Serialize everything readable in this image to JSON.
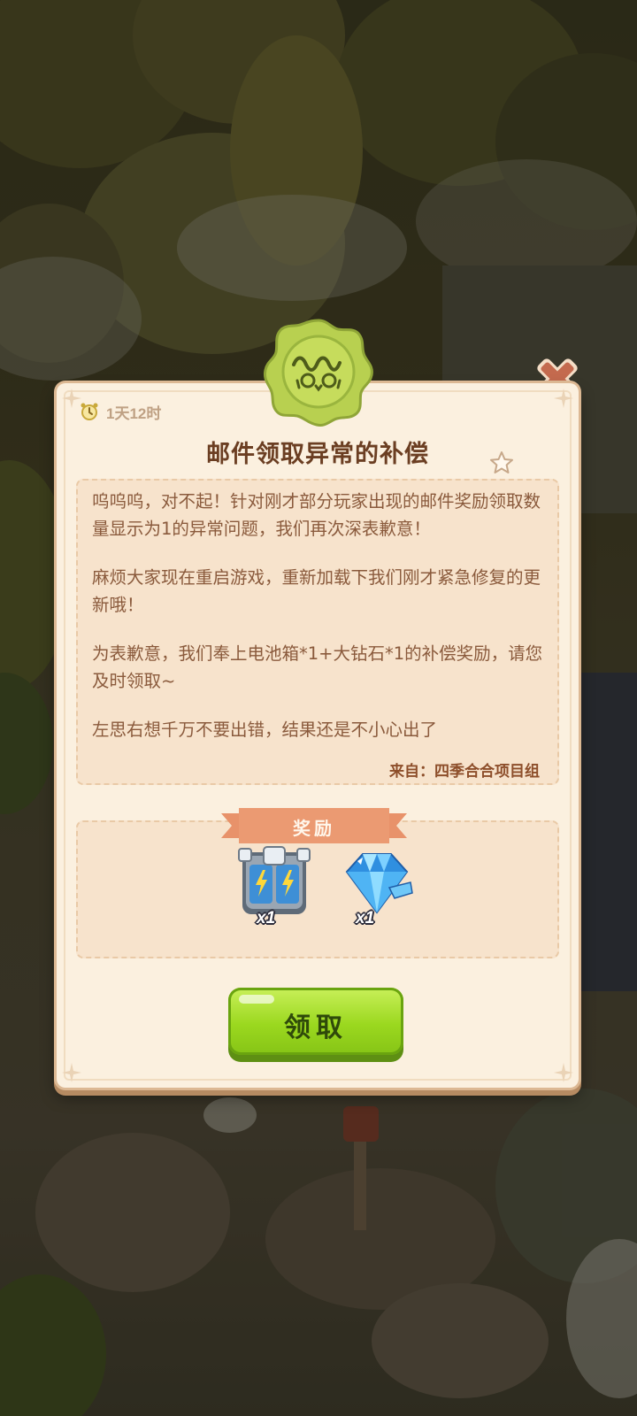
{
  "mail": {
    "time_left": "1天12时",
    "title": "邮件领取异常的补偿",
    "body": [
      "呜呜呜，对不起！针对刚才部分玩家出现的邮件奖励领取数量显示为1的异常问题，我们再次深表歉意！",
      "麻烦大家现在重启游戏，重新加载下我们刚才紧急修复的更新哦！",
      "为表歉意，我们奉上电池箱*1+大钻石*1的补偿奖励，请您及时领取~",
      "左思右想千万不要出错，结果还是不小心出了"
    ],
    "sender": "来自：四季合合项目组"
  },
  "rewards": {
    "header": "奖励",
    "items": [
      {
        "icon": "battery-box-icon",
        "qty": "x1"
      },
      {
        "icon": "diamond-icon",
        "qty": "x1"
      }
    ]
  },
  "buttons": {
    "claim": "领取"
  },
  "colors": {
    "panel": "#fbf0df",
    "panel_border": "#dcb893",
    "title": "#6b3e22",
    "body_text": "#8a5a3c",
    "banner": "#e8926a",
    "claim_button": "#9bd81f",
    "seal": "#b8d050",
    "close": "#c46a4e"
  }
}
